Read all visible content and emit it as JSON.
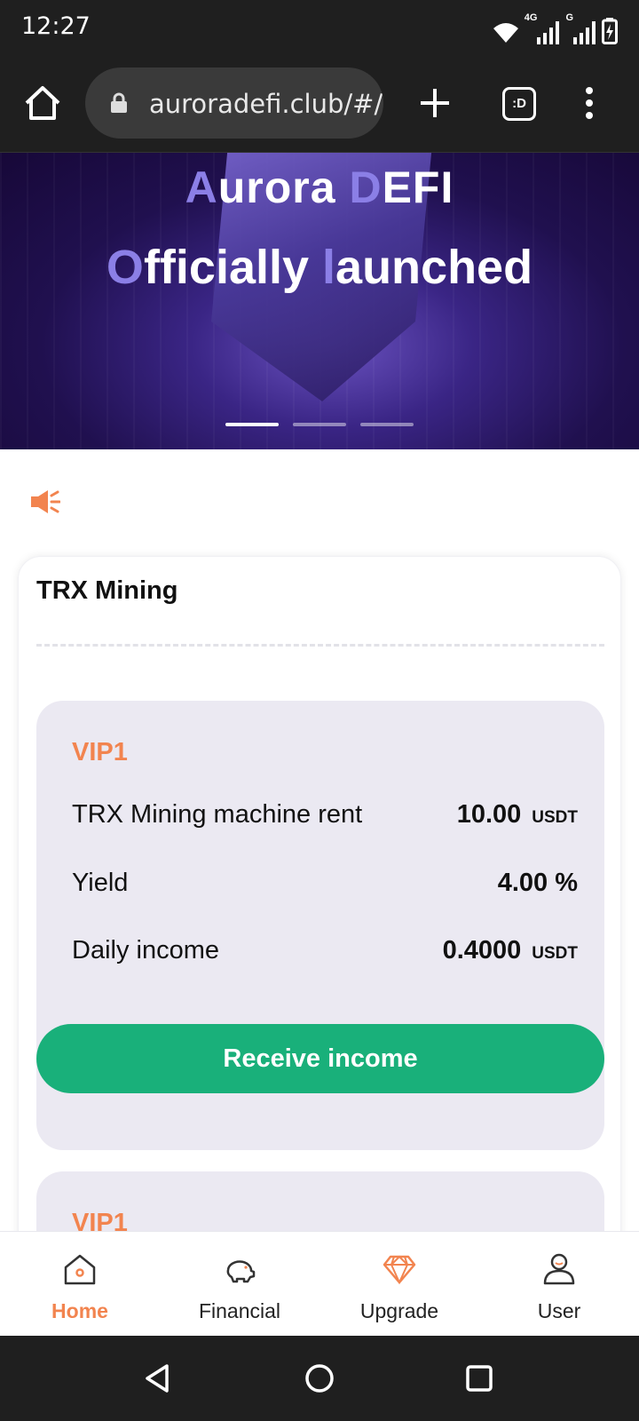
{
  "status_bar": {
    "time": "12:27",
    "network_label_1": "4G",
    "network_label_2": "G"
  },
  "browser": {
    "url": "auroradefi.club/#/",
    "tabs_label": ":D"
  },
  "banner": {
    "line1_parts": [
      "A",
      "urora ",
      "D",
      "EFI"
    ],
    "line2_parts": [
      "O",
      "fficially ",
      "l",
      "aunched"
    ],
    "slides": 3,
    "active_slide": 1
  },
  "card": {
    "title": "TRX Mining",
    "plans": [
      {
        "vip": "VIP1",
        "rows": [
          {
            "label": "TRX Mining machine rent",
            "value": "10.00",
            "unit": "USDT"
          },
          {
            "label": "Yield",
            "value": "4.00",
            "unit": "%"
          },
          {
            "label": "Daily income",
            "value": "0.4000",
            "unit": "USDT"
          }
        ],
        "button_label": "Receive income"
      },
      {
        "vip": "VIP1"
      }
    ]
  },
  "bottom_nav": {
    "items": [
      {
        "label": "Home",
        "icon": "home-icon",
        "active": true
      },
      {
        "label": "Financial",
        "icon": "piggy-bank-icon",
        "active": false
      },
      {
        "label": "Upgrade",
        "icon": "diamond-icon",
        "active": false
      },
      {
        "label": "User",
        "icon": "user-icon",
        "active": false
      }
    ]
  },
  "colors": {
    "accent": "#f2844f",
    "button": "#19b07a",
    "plan_bg": "#ebe9f2",
    "banner": "#20104f"
  }
}
